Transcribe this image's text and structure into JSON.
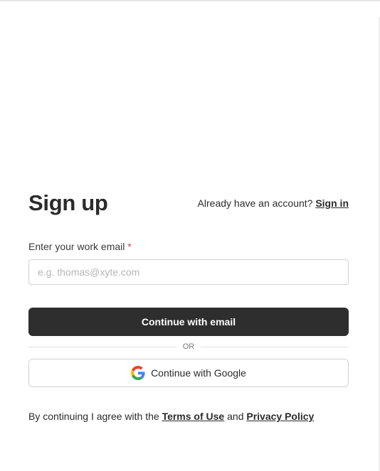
{
  "header": {
    "title": "Sign up",
    "signin_prompt": "Already have an account?",
    "signin_link": "Sign in"
  },
  "email": {
    "label": "Enter your work email",
    "required_mark": "*",
    "placeholder": "e.g. thomas@xyte.com",
    "value": ""
  },
  "buttons": {
    "continue_email": "Continue with email",
    "divider": "OR",
    "continue_google": "Continue with Google"
  },
  "icons": {
    "google": "google-logo-icon"
  },
  "terms": {
    "prefix": "By continuing I agree with the",
    "terms_link": "Terms of Use",
    "conjunction": "and",
    "privacy_link": "Privacy Policy"
  },
  "colors": {
    "primary_button": "#2e2e2e",
    "required": "#d64545",
    "border": "#d2d2d2"
  }
}
